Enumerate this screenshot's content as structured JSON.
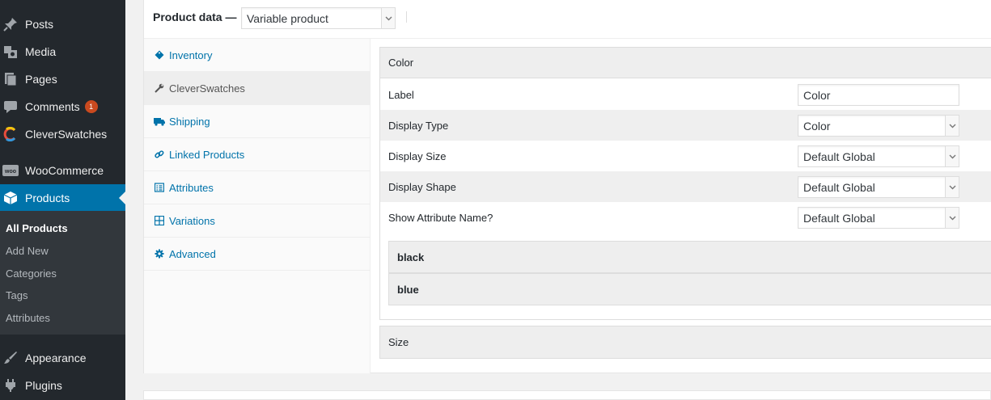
{
  "sidebar": {
    "menu": [
      {
        "label": "Posts",
        "icon": "pushpin-icon"
      },
      {
        "label": "Media",
        "icon": "media-icon"
      },
      {
        "label": "Pages",
        "icon": "pages-icon"
      },
      {
        "label": "Comments",
        "icon": "comment-icon",
        "badge": "1"
      },
      {
        "label": "CleverSwatches",
        "icon": "cleverswatches-logo-icon"
      },
      {
        "label": "WooCommerce",
        "icon": "woocommerce-icon"
      },
      {
        "label": "Products",
        "icon": "products-box-icon",
        "active": true
      },
      {
        "label": "Appearance",
        "icon": "paintbrush-icon"
      },
      {
        "label": "Plugins",
        "icon": "plugin-icon"
      }
    ],
    "submenu": [
      "All Products",
      "Add New",
      "Categories",
      "Tags",
      "Attributes"
    ],
    "colors": {
      "bg": "#23282d",
      "active": "#0073aa",
      "submenu_bg": "#32373c",
      "badge": "#ca4a1f"
    }
  },
  "product_data": {
    "title": "Product data —",
    "type_select": "Variable product",
    "tabs": [
      {
        "label": "Inventory",
        "icon": "tag-icon"
      },
      {
        "label": "CleverSwatches",
        "icon": "wrench-icon",
        "active": true
      },
      {
        "label": "Shipping",
        "icon": "truck-icon"
      },
      {
        "label": "Linked Products",
        "icon": "link-icon"
      },
      {
        "label": "Attributes",
        "icon": "list-icon"
      },
      {
        "label": "Variations",
        "icon": "grid-icon"
      },
      {
        "label": "Advanced",
        "icon": "gear-icon"
      }
    ]
  },
  "swatches": {
    "color_attr": {
      "title": "Color",
      "label_field": {
        "label": "Label",
        "value": "Color"
      },
      "display_type": {
        "label": "Display Type",
        "value": "Color"
      },
      "display_size": {
        "label": "Display Size",
        "value": "Default Global"
      },
      "display_shape": {
        "label": "Display Shape",
        "value": "Default Global"
      },
      "show_name": {
        "label": "Show Attribute Name?",
        "value": "Default Global"
      },
      "terms": [
        "black",
        "blue"
      ]
    },
    "size_attr": {
      "title": "Size"
    }
  }
}
